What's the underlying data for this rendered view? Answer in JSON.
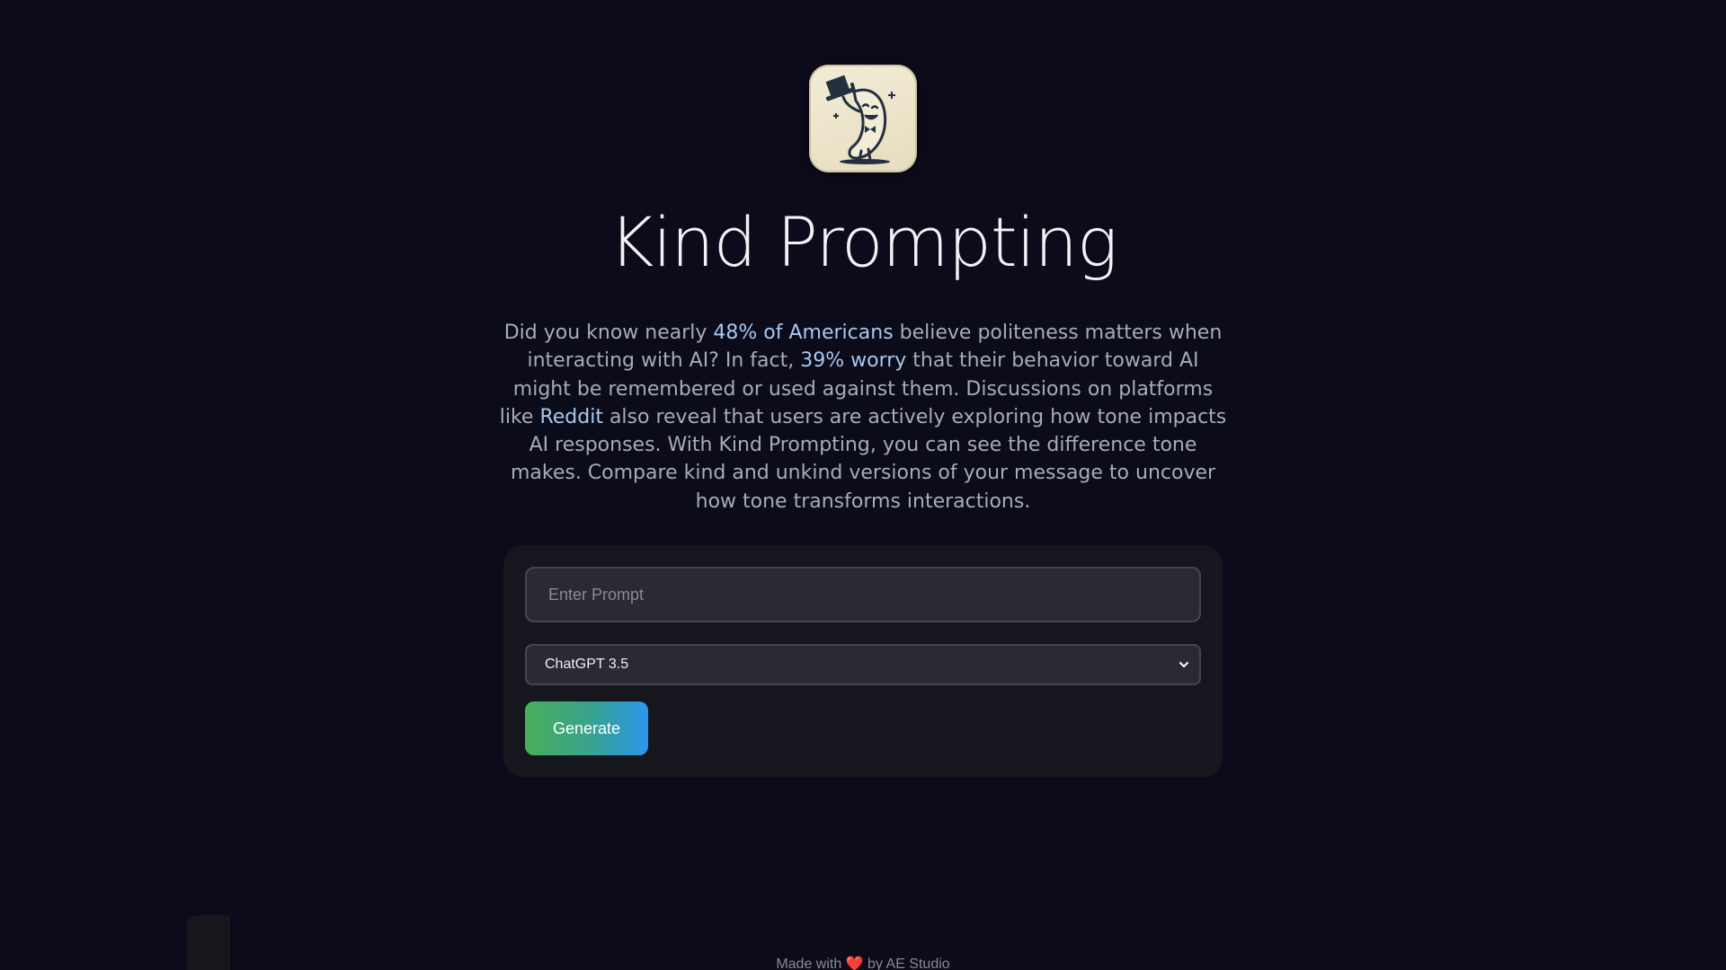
{
  "app": {
    "title": "Kind Prompting",
    "logo_icon": "banana-mascot-icon"
  },
  "intro": {
    "part1": "Did you know nearly ",
    "link1": "48% of Americans",
    "part2": " believe politeness matters when interacting with AI? In fact, ",
    "link2": "39% worry",
    "part3": " that their behavior toward AI might be remembered or used against them. Discussions on platforms like ",
    "link3": "Reddit",
    "part4": " also reveal that users are actively exploring how tone impacts AI responses. With Kind Prompting, you can see the difference tone makes. Compare kind and unkind versions of your message to uncover how tone transforms interactions."
  },
  "form": {
    "prompt_placeholder": "Enter Prompt",
    "prompt_value": "",
    "model_selected": "ChatGPT 3.5",
    "generate_label": "Generate"
  },
  "footer": {
    "made_with": "Made with ",
    "heart": "❤️",
    "by": " by AE Studio"
  },
  "colors": {
    "background": "#0b0b1a",
    "card": "#16161f",
    "link": "#a8c8f0",
    "button_gradient_start": "#48b05a",
    "button_gradient_end": "#2a98ec"
  }
}
